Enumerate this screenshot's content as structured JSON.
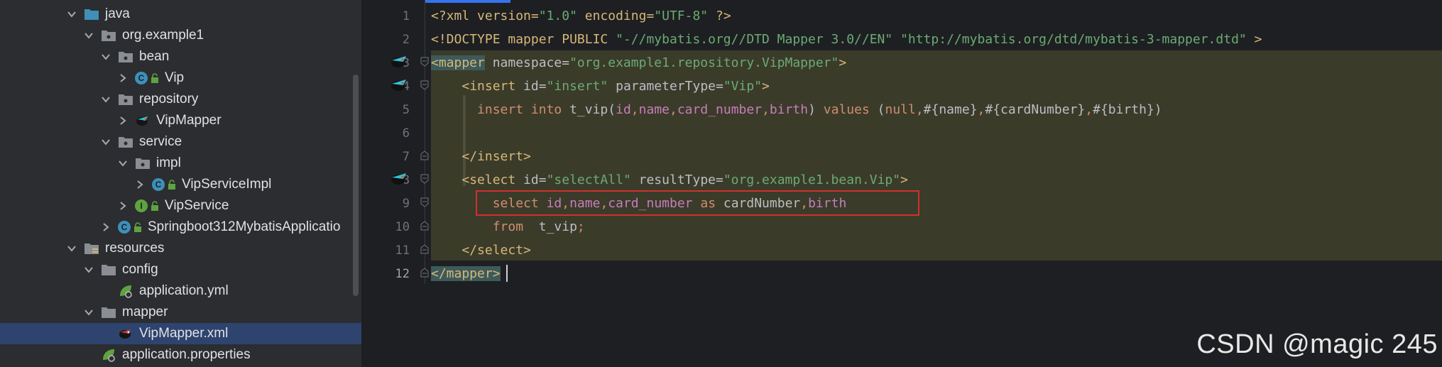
{
  "project_tree": {
    "nodes": [
      {
        "label": "java",
        "kind": "folder-blue",
        "expanded": true
      },
      {
        "label": "org.example1",
        "kind": "package",
        "expanded": true
      },
      {
        "label": "bean",
        "kind": "package",
        "expanded": true
      },
      {
        "label": "Vip",
        "kind": "class",
        "expanded": false
      },
      {
        "label": "repository",
        "kind": "package",
        "expanded": true
      },
      {
        "label": "VipMapper",
        "kind": "mapper-interface",
        "expanded": false
      },
      {
        "label": "service",
        "kind": "package",
        "expanded": true
      },
      {
        "label": "impl",
        "kind": "package",
        "expanded": true
      },
      {
        "label": "VipServiceImpl",
        "kind": "class",
        "expanded": false
      },
      {
        "label": "VipService",
        "kind": "interface",
        "expanded": false
      },
      {
        "label": "Springboot312MybatisApplicatio",
        "kind": "spring-class",
        "expanded": false
      },
      {
        "label": "resources",
        "kind": "resources-folder",
        "expanded": true
      },
      {
        "label": "config",
        "kind": "folder",
        "expanded": true
      },
      {
        "label": "application.yml",
        "kind": "spring-config",
        "expanded": false
      },
      {
        "label": "mapper",
        "kind": "folder",
        "expanded": true
      },
      {
        "label": "VipMapper.xml",
        "kind": "mybatis-xml",
        "expanded": false,
        "selected": true
      },
      {
        "label": "application.properties",
        "kind": "spring-config",
        "expanded": false
      }
    ],
    "class_badge": "C",
    "interface_badge": "I"
  },
  "editor": {
    "line_numbers": [
      "1",
      "2",
      "3",
      "4",
      "5",
      "6",
      "7",
      "8",
      "9",
      "10",
      "11",
      "12"
    ],
    "current_line": "12",
    "lines": {
      "l1": {
        "a": "<?xml version=",
        "b": "\"1.0\"",
        "c": " encoding=",
        "d": "\"UTF-8\"",
        "e": " ?>"
      },
      "l2": {
        "a": "<!DOCTYPE mapper PUBLIC ",
        "b": "\"-//mybatis.org//DTD Mapper 3.0//EN\"",
        "c": " ",
        "d": "\"http://mybatis.org/dtd/mybatis-3-mapper.dtd\"",
        "e": " >"
      },
      "l3": {
        "a": "<mapper",
        "b": " namespace=",
        "c": "\"org.example1.repository.VipMapper\"",
        "d": ">"
      },
      "l4": {
        "indent": "    ",
        "a": "<insert",
        "b": " id=",
        "c": "\"insert\"",
        "d": " parameterType=",
        "e": "\"Vip\"",
        "f": ">"
      },
      "l5": {
        "indent": "      ",
        "k1": "insert into ",
        "t1": "t_vip(",
        "f1": "id",
        "p1": ",",
        "f2": "name",
        "p2": ",",
        "f3": "card_number",
        "p3": ",",
        "f4": "birth",
        "t2": ") ",
        "k2": "values ",
        "t3": "(",
        "k3": "null,",
        "t4": "#{name}",
        "k4": ",",
        "t5": "#{cardNumber}",
        "k5": ",",
        "t6": "#{birth})"
      },
      "l7": {
        "indent": "    ",
        "a": "</insert>"
      },
      "l8": {
        "indent": "    ",
        "a": "<select",
        "b": " id=",
        "c": "\"selectAll\"",
        "d": " resultType=",
        "e": "\"org.example1.bean.Vip\"",
        "f": ">"
      },
      "l9": {
        "indent": "        ",
        "k1": "select ",
        "f1": "id",
        "p1": ",",
        "f2": "name",
        "p2": ",",
        "f3": "card_number",
        "k2": " as ",
        "t1": "cardNumber",
        "p3": ",",
        "f4": "birth"
      },
      "l10": {
        "indent": "        ",
        "k1": "from",
        "t1": "  t_vip",
        "k2": ";"
      },
      "l11": {
        "indent": "    ",
        "a": "</select>"
      },
      "l12": {
        "a": "</mapper>"
      }
    }
  },
  "watermark": "CSDN @magic 245",
  "colors": {
    "tag": "#d5b778",
    "string": "#6aab73",
    "keyword": "#cf8e6d",
    "field": "#c77dbb",
    "text": "#bcbec4",
    "highlight_box": "#d0312d",
    "selection": "#2e436e"
  }
}
